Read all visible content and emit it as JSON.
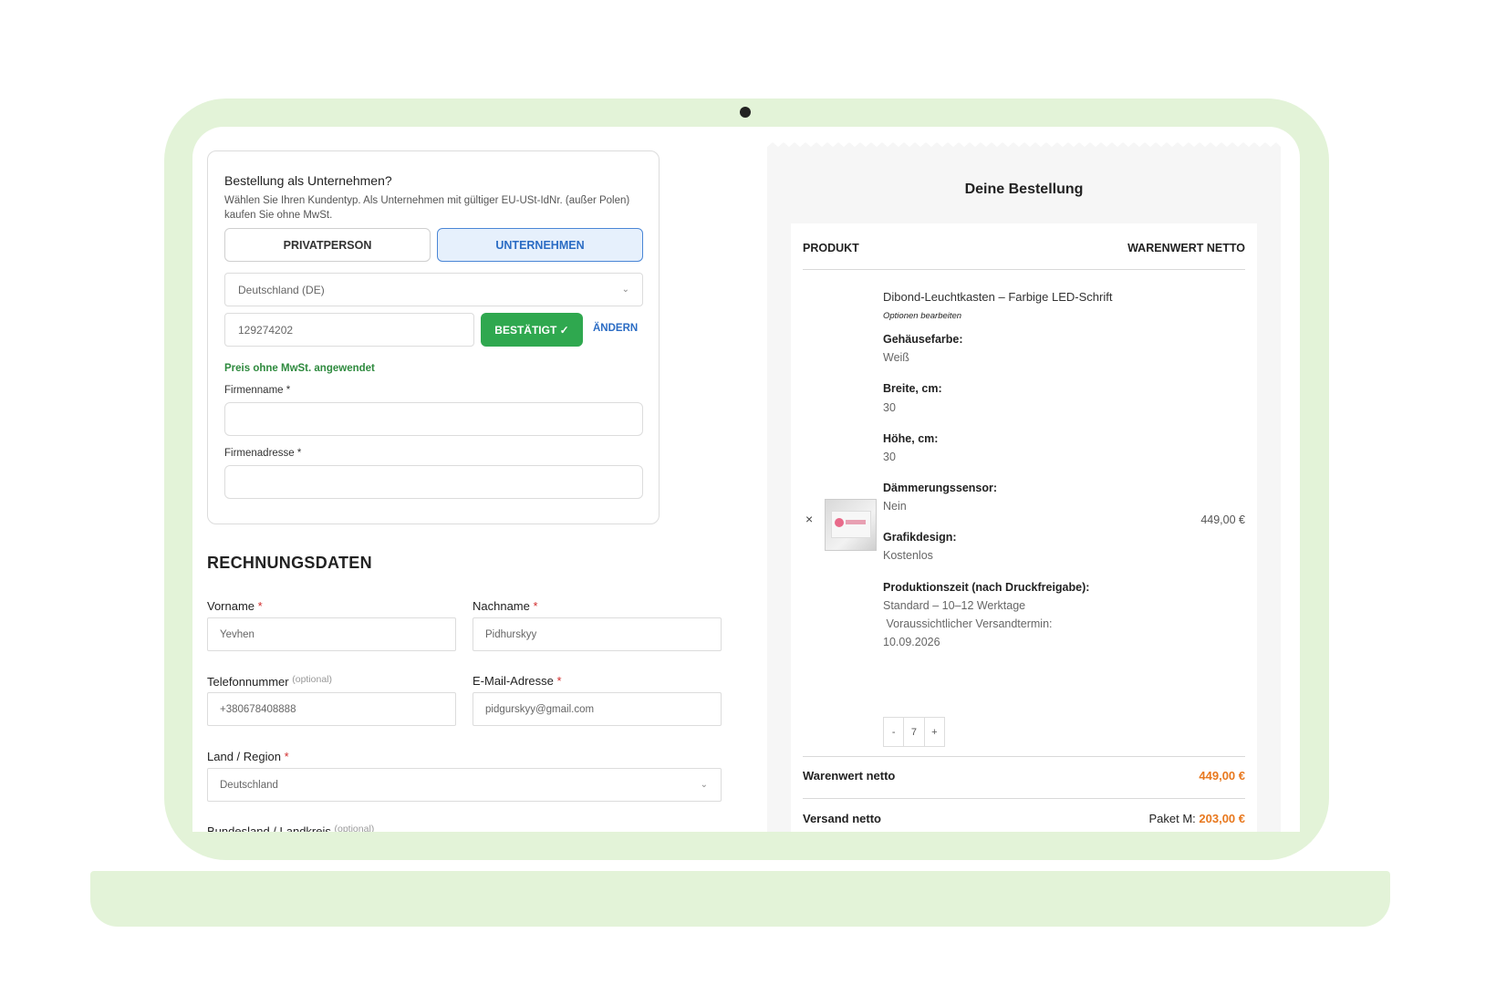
{
  "company_section": {
    "title": "Bestellung als Unternehmen?",
    "description": "Wählen Sie Ihren Kundentyp. Als Unternehmen mit gültiger EU-USt-IdNr. (außer Polen) kaufen Sie ohne MwSt.",
    "private_label": "PRIVATPERSON",
    "company_label": "UNTERNEHMEN",
    "country_value": "Deutschland (DE)",
    "vat_value": "129274202",
    "confirmed_label": "BESTÄTIGT ✓",
    "change_label": "ÄNDERN",
    "vat_note": "Preis ohne MwSt. angewendet",
    "company_name_label": "Firmenname *",
    "company_address_label": "Firmenadresse *"
  },
  "billing": {
    "title": "RECHNUNGSDATEN",
    "first_name_label": "Vorname",
    "first_name_value": "Yevhen",
    "last_name_label": "Nachname",
    "last_name_value": "Pidhurskyy",
    "phone_label": "Telefonnummer",
    "phone_value": "+380678408888",
    "email_label": "E-Mail-Adresse",
    "email_value": "pidgurskyy@gmail.com",
    "country_label": "Land / Region",
    "country_value": "Deutschland",
    "state_label": "Bundesland / Landkreis",
    "optional": "(optional)",
    "required_mark": "*"
  },
  "order": {
    "title": "Deine Bestellung",
    "col_product": "PRODUKT",
    "col_value": "WARENWERT NETTO",
    "product_name": "Dibond-Leuchtkasten – Farbige LED-Schrift",
    "edit_options": "Optionen bearbeiten",
    "options": [
      {
        "key": "Gehäusefarbe:",
        "value": "Weiß"
      },
      {
        "key": "Breite, cm:",
        "value": "30"
      },
      {
        "key": "Höhe, cm:",
        "value": "30"
      },
      {
        "key": "Dämmerungssensor:",
        "value": "Nein"
      },
      {
        "key": "Grafikdesign:",
        "value": "Kostenlos"
      },
      {
        "key": "Produktionszeit (nach Druckfreigabe):",
        "value_lines": [
          "Standard – 10–12 Werktage",
          " Voraussichtlicher Versandtermin:",
          "10.09.2026"
        ]
      }
    ],
    "item_price": "449,00 €",
    "remove": "×",
    "qty_minus": "-",
    "qty_value": "7",
    "qty_plus": "+",
    "subtotal_label": "Warenwert netto",
    "subtotal_value": "449,00 €",
    "shipping_label": "Versand netto",
    "shipping_prefix": "Paket M: ",
    "shipping_value": "203,00 €"
  },
  "colors": {
    "frame": "#e3f3d8",
    "confirmed": "#2fa84f",
    "accent_blue": "#2b6cc4",
    "price_orange": "#e8781e",
    "required_red": "#d12c2c"
  }
}
